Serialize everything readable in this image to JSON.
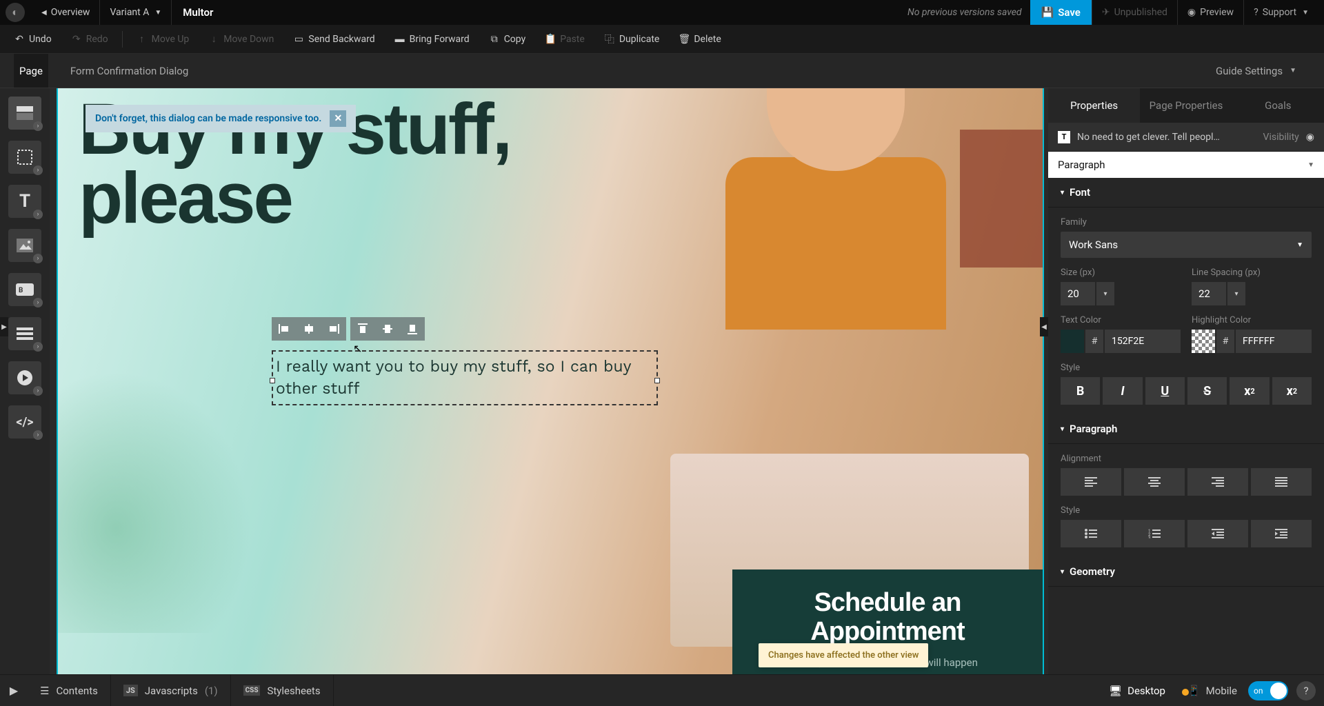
{
  "topbar": {
    "overview": "Overview",
    "variant": "Variant A",
    "title": "Multor",
    "status": "No previous versions saved",
    "save": "Save",
    "unpublished": "Unpublished",
    "preview": "Preview",
    "support": "Support"
  },
  "actionbar": {
    "undo": "Undo",
    "redo": "Redo",
    "move_up": "Move Up",
    "move_down": "Move Down",
    "send_backward": "Send Backward",
    "bring_forward": "Bring Forward",
    "copy": "Copy",
    "paste": "Paste",
    "duplicate": "Duplicate",
    "delete": "Delete"
  },
  "subheader": {
    "tabs": [
      "Page",
      "Form Confirmation Dialog"
    ],
    "guide": "Guide Settings"
  },
  "canvas": {
    "notice": "Don't forget, this dialog can be made responsive too.",
    "hero_title_line1": "Buy my stuff,",
    "hero_title_line2": "please",
    "paragraph": "I really want you to buy my stuff, so I can buy other stuff",
    "schedule_line1": "Schedule an",
    "schedule_line2": "Appointment",
    "schedule_sub": "Here, let visitors know what will happen",
    "warn": "Changes have affected the other view"
  },
  "left_tools": [
    "section",
    "box",
    "text",
    "image",
    "button",
    "form",
    "video",
    "custom-html"
  ],
  "properties": {
    "tabs": [
      "Properties",
      "Page Properties",
      "Goals"
    ],
    "selected": "No need to get clever. Tell peopl…",
    "visibility": "Visibility",
    "element_type": "Paragraph",
    "sections": {
      "font": "Font",
      "paragraph": "Paragraph",
      "geometry": "Geometry"
    },
    "font": {
      "family_label": "Family",
      "family_value": "Work Sans",
      "size_label": "Size (px)",
      "size_value": "20",
      "line_label": "Line Spacing (px)",
      "line_value": "22",
      "text_color_label": "Text Color",
      "text_color_value": "152F2E",
      "highlight_label": "Highlight Color",
      "highlight_value": "FFFFFF",
      "style_label": "Style",
      "style_buttons": {
        "bold": "B",
        "italic": "I",
        "underline": "U",
        "strike": "S",
        "sup": "x",
        "sub": "x"
      }
    },
    "paragraph": {
      "alignment_label": "Alignment",
      "style_label": "Style"
    }
  },
  "bottombar": {
    "contents": "Contents",
    "javascripts": "Javascripts",
    "js_count": "(1)",
    "stylesheets": "Stylesheets",
    "desktop": "Desktop",
    "mobile": "Mobile",
    "toggle": "on"
  }
}
